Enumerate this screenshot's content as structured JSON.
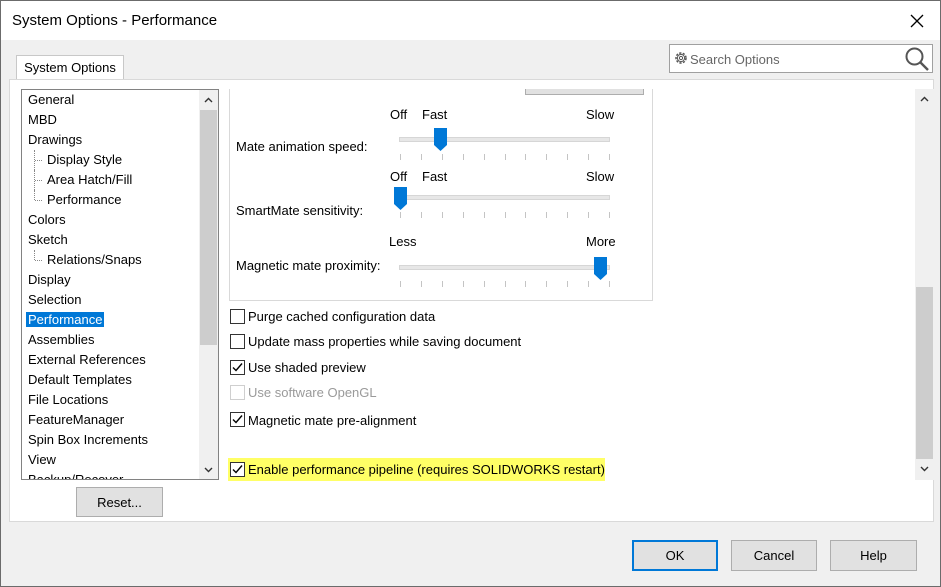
{
  "window": {
    "title": "System Options - Performance"
  },
  "search": {
    "placeholder": "Search Options"
  },
  "tabs": [
    {
      "label": "System Options"
    }
  ],
  "tree": {
    "items": [
      {
        "label": "General",
        "child": false,
        "selected": false
      },
      {
        "label": "MBD",
        "child": false,
        "selected": false
      },
      {
        "label": "Drawings",
        "child": false,
        "selected": false
      },
      {
        "label": "Display Style",
        "child": true,
        "selected": false
      },
      {
        "label": "Area Hatch/Fill",
        "child": true,
        "selected": false
      },
      {
        "label": "Performance",
        "child": true,
        "selected": false,
        "last": true
      },
      {
        "label": "Colors",
        "child": false,
        "selected": false
      },
      {
        "label": "Sketch",
        "child": false,
        "selected": false
      },
      {
        "label": "Relations/Snaps",
        "child": true,
        "selected": false,
        "last": true
      },
      {
        "label": "Display",
        "child": false,
        "selected": false
      },
      {
        "label": "Selection",
        "child": false,
        "selected": false
      },
      {
        "label": "Performance",
        "child": false,
        "selected": true
      },
      {
        "label": "Assemblies",
        "child": false,
        "selected": false
      },
      {
        "label": "External References",
        "child": false,
        "selected": false
      },
      {
        "label": "Default Templates",
        "child": false,
        "selected": false
      },
      {
        "label": "File Locations",
        "child": false,
        "selected": false
      },
      {
        "label": "FeatureManager",
        "child": false,
        "selected": false
      },
      {
        "label": "Spin Box Increments",
        "child": false,
        "selected": false
      },
      {
        "label": "View",
        "child": false,
        "selected": false
      },
      {
        "label": "Backup/Recover",
        "child": false,
        "selected": false
      }
    ]
  },
  "sliders": {
    "mate_animation": {
      "label": "Mate animation speed:",
      "left": "Off",
      "mid": "Fast",
      "right": "Slow",
      "value_fraction": 0.19
    },
    "smartmate": {
      "label": "SmartMate sensitivity:",
      "left": "Off",
      "mid": "Fast",
      "right": "Slow",
      "value_fraction": 0.0
    },
    "magnetic_proximity": {
      "label": "Magnetic mate proximity:",
      "left": "Less",
      "right": "More",
      "value_fraction": 0.95
    }
  },
  "options": {
    "purge": {
      "label": "Purge cached configuration data",
      "checked": false
    },
    "mass_props": {
      "label": "Update mass properties while saving document",
      "checked": false
    },
    "shaded_preview": {
      "label": "Use shaded preview",
      "checked": true
    },
    "software_opengl": {
      "label": "Use software OpenGL",
      "checked": false,
      "disabled": true
    },
    "magnetic_prealign": {
      "label": "Magnetic mate pre-alignment",
      "checked": true
    },
    "perf_pipeline": {
      "label": "Enable performance pipeline (requires SOLIDWORKS restart)",
      "checked": true,
      "highlighted": true
    }
  },
  "buttons": {
    "reset": "Reset...",
    "ok": "OK",
    "cancel": "Cancel",
    "help": "Help"
  },
  "colors": {
    "accent": "#0078d7",
    "highlight": "#ffff66"
  },
  "icons": [
    "close-icon",
    "gear-icon",
    "search-icon",
    "chevron-up-icon",
    "chevron-down-icon",
    "checkmark-icon"
  ]
}
